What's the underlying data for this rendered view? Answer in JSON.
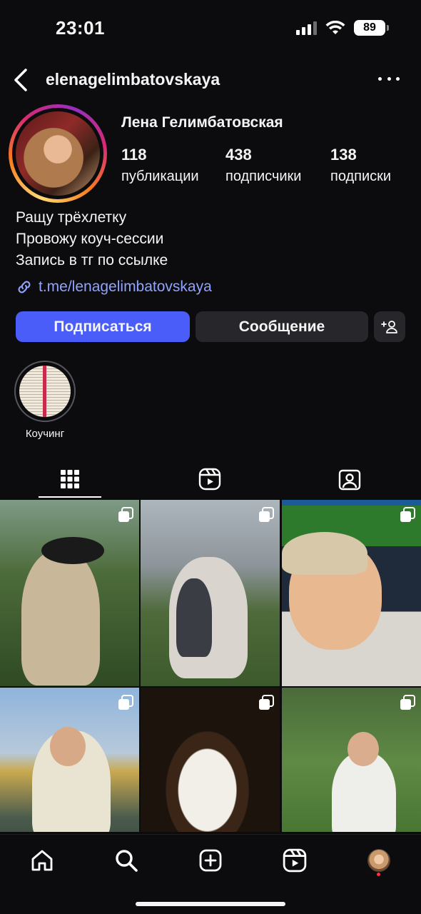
{
  "status": {
    "time": "23:01",
    "battery": "89"
  },
  "header": {
    "username": "elenagelimbatovskaya"
  },
  "profile": {
    "display_name": "Лена Гелимбатовская",
    "stats": [
      {
        "number": "118",
        "label": "публикации"
      },
      {
        "number": "438",
        "label": "подписчики"
      },
      {
        "number": "138",
        "label": "подписки"
      }
    ],
    "bio": [
      "Ращу трёхлетку",
      "Провожу коуч-сессии",
      "Запись в тг по ссылке"
    ],
    "link": "t.me/lenagelimbatovskaya"
  },
  "actions": {
    "follow": "Подписаться",
    "message": "Сообщение"
  },
  "highlights": [
    {
      "label": "Коучинг"
    }
  ],
  "tabs": [
    "grid",
    "reels",
    "tagged"
  ],
  "colors": {
    "accent": "#4a5df9",
    "link": "#8fa3ff",
    "background": "#0c0c0e",
    "button_secondary": "#26262b"
  }
}
